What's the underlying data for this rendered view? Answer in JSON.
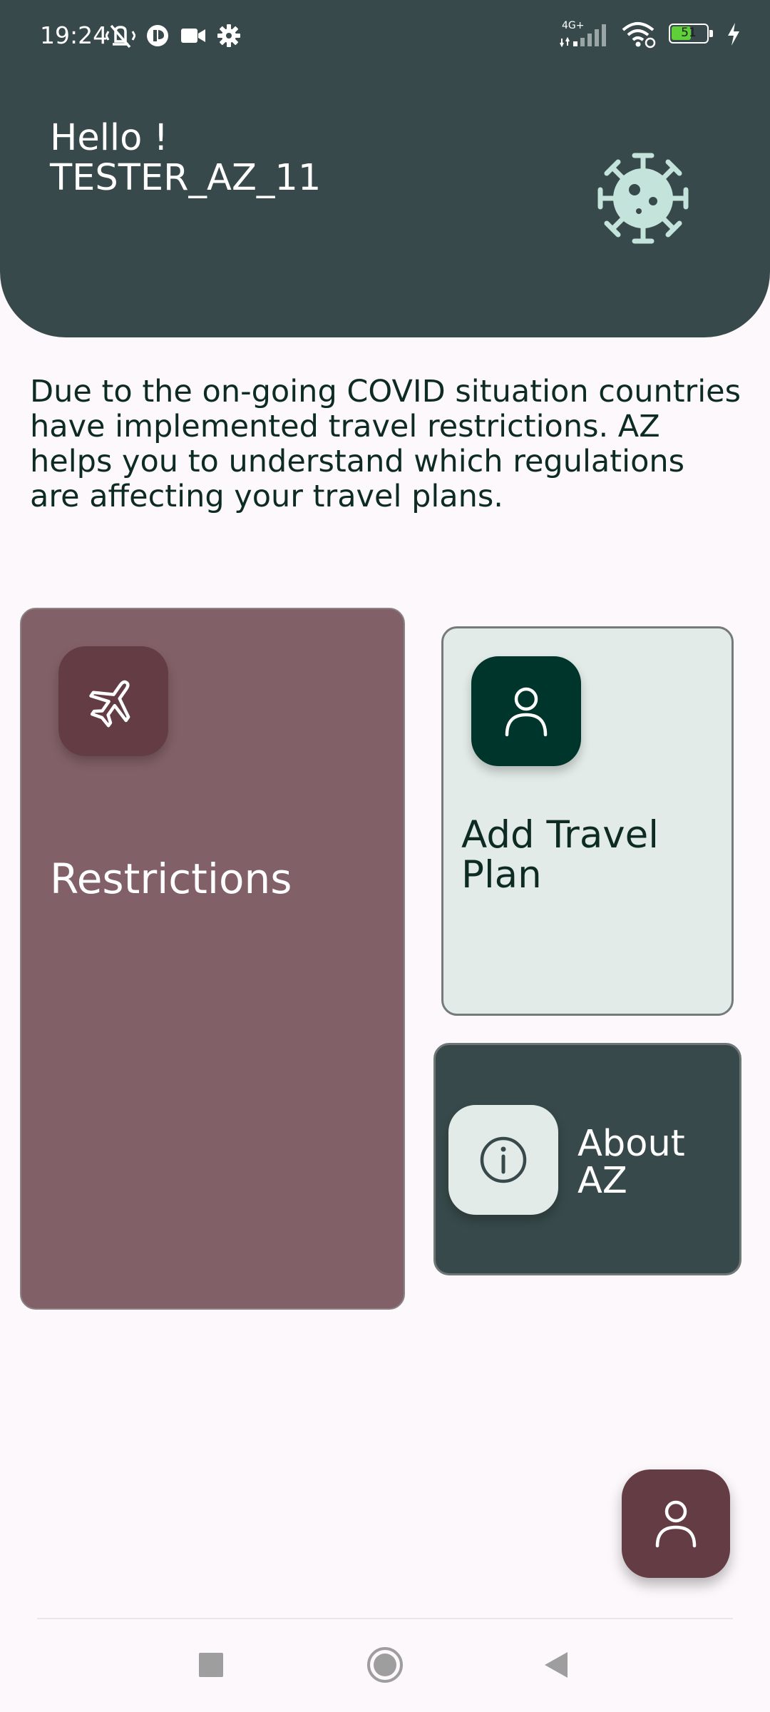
{
  "status_bar": {
    "time": "19:24",
    "network_label": "4G+",
    "battery_level": "51",
    "icons": [
      "mute-vibrate-icon",
      "app-notification-icon",
      "video-icon",
      "settings-icon",
      "signal-icon",
      "wifi-icon",
      "battery-icon",
      "charging-icon"
    ]
  },
  "header": {
    "greeting_line1": "Hello !",
    "greeting_line2": "TESTER_AZ_11",
    "icon": "virus-icon",
    "background": "#37494a"
  },
  "intro": {
    "text": "Due to the on-going COVID situation countries have implemented travel restrictions. AZ helps you to understand which regulations are affecting your travel plans."
  },
  "cards": {
    "restrictions": {
      "label": "Restrictions",
      "icon": "airplane-icon",
      "color": "#826067"
    },
    "add_travel_plan": {
      "label": "Add Travel Plan",
      "icon": "person-icon",
      "color": "#e2ebe8"
    },
    "about": {
      "label": "About AZ",
      "icon": "info-icon",
      "color": "#37494a"
    }
  },
  "fab": {
    "icon": "profile-icon",
    "color": "#633c44"
  },
  "nav_bar": {
    "buttons": [
      "recents-button",
      "home-button",
      "back-button"
    ]
  }
}
